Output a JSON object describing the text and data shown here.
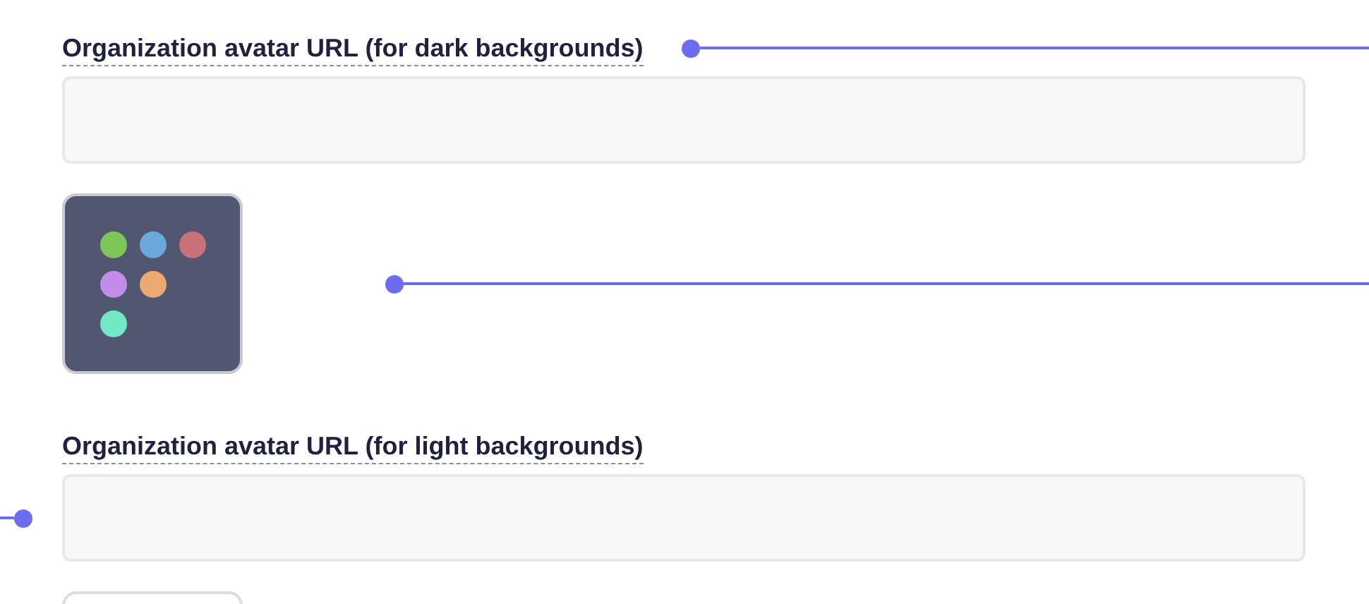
{
  "items": [
    {
      "kind": "url-field",
      "label": "Organization avatar URL (for dark backgrounds)",
      "leader_right": true,
      "leader_left": false
    },
    {
      "kind": "avatar-preview",
      "leader_right": true,
      "dots": [
        {
          "color": "#7ec657"
        },
        {
          "color": "#6aa9da"
        },
        {
          "color": "#c87178"
        },
        {
          "color": "#c18de8"
        },
        {
          "color": "#eda970"
        },
        {
          "color": "#72e8c5"
        }
      ]
    },
    {
      "kind": "url-field",
      "label": "Organization avatar URL (for light backgrounds)",
      "leader_right": false,
      "leader_left": true
    },
    {
      "kind": "avatar-preview"
    }
  ]
}
